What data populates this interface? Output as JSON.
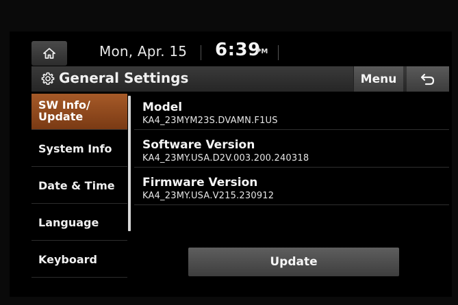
{
  "status": {
    "date": "Mon, Apr. 15",
    "time": "6:39",
    "ampm": "PM"
  },
  "header": {
    "title": "General Settings",
    "menu_label": "Menu"
  },
  "sidebar": {
    "items": [
      {
        "label": "SW Info/\nUpdate",
        "active": true
      },
      {
        "label": "System Info",
        "active": false
      },
      {
        "label": "Date & Time",
        "active": false
      },
      {
        "label": "Language",
        "active": false
      },
      {
        "label": "Keyboard",
        "active": false
      }
    ]
  },
  "info": [
    {
      "label": "Model",
      "value": "KA4_23MYM23S.DVAMN.F1US"
    },
    {
      "label": "Software Version",
      "value": "KA4_23MY.USA.D2V.003.200.240318"
    },
    {
      "label": "Firmware Version",
      "value": "KA4_23MY.USA.V215.230912"
    }
  ],
  "update_label": "Update",
  "colors": {
    "accent": "#a65a28",
    "background": "#000000",
    "bar": "#333333"
  },
  "icons": [
    "home-icon",
    "gear-icon",
    "back-arrow-icon"
  ]
}
